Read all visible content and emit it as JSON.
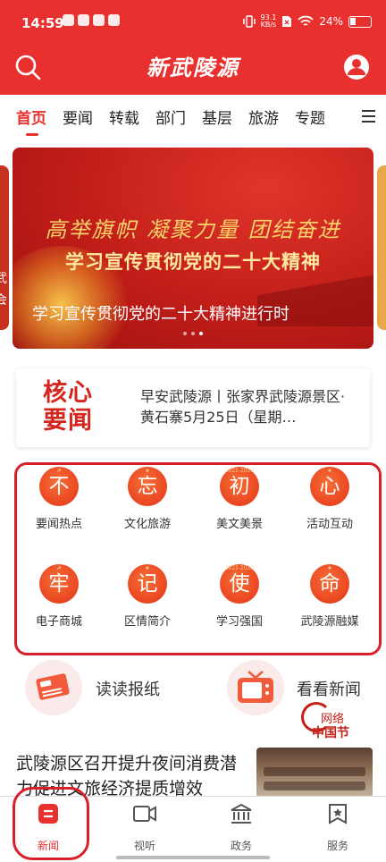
{
  "status_bar": {
    "time": "14:59",
    "speed_value": "93.1",
    "speed_unit": "KB/s",
    "battery": "24%"
  },
  "header": {
    "logo": "新武陵源"
  },
  "tabs": [
    "首页",
    "要闻",
    "转载",
    "部门",
    "基层",
    "旅游",
    "专题"
  ],
  "banner": {
    "slogan_line1": "高举旗帜 凝聚力量 团结奋进",
    "slogan_line2": "学习宣传贯彻党的二十大精神",
    "caption": "学习宣传贯彻党的二十大精神进行时",
    "side_left_text": "武\n会",
    "slide_count": 3,
    "active_slide": 2
  },
  "core_news": {
    "badge_line1": "核心",
    "badge_line2": "要闻",
    "text": "早安武陵源丨张家界武陵源景区·黄石寨5月25日（星期…"
  },
  "grid": [
    {
      "glyph": "不",
      "label": "要闻热点",
      "mark": "☭"
    },
    {
      "glyph": "忘",
      "label": "文化旅游",
      "mark": "★"
    },
    {
      "glyph": "初",
      "label": "美文美景",
      "mark": "2021-2023"
    },
    {
      "glyph": "心",
      "label": "活动互动",
      "mark": "★"
    },
    {
      "glyph": "牢",
      "label": "电子商城",
      "mark": "☭"
    },
    {
      "glyph": "记",
      "label": "区情简介",
      "mark": "★"
    },
    {
      "glyph": "使",
      "label": "学习强国",
      "mark": "2021-2023"
    },
    {
      "glyph": "命",
      "label": "武陵源融媒",
      "mark": "★"
    }
  ],
  "papers": [
    {
      "label": "读读报纸",
      "icon": "newspaper-icon"
    },
    {
      "label": "看看新闻",
      "icon": "tv-icon"
    }
  ],
  "festival_badge": {
    "line1": "网络",
    "line2": "中国节"
  },
  "headline": "武陵源区召开提升夜间消费潜力促进文旅经济提质增效",
  "bottom_nav": [
    {
      "label": "新闻",
      "icon": "news-icon"
    },
    {
      "label": "视听",
      "icon": "video-icon"
    },
    {
      "label": "政务",
      "icon": "government-icon"
    },
    {
      "label": "服务",
      "icon": "service-icon"
    }
  ],
  "colors": {
    "brand_red": "#e8312f",
    "highlight_red": "#d8202a",
    "grid_orange": "#ec4b24"
  }
}
